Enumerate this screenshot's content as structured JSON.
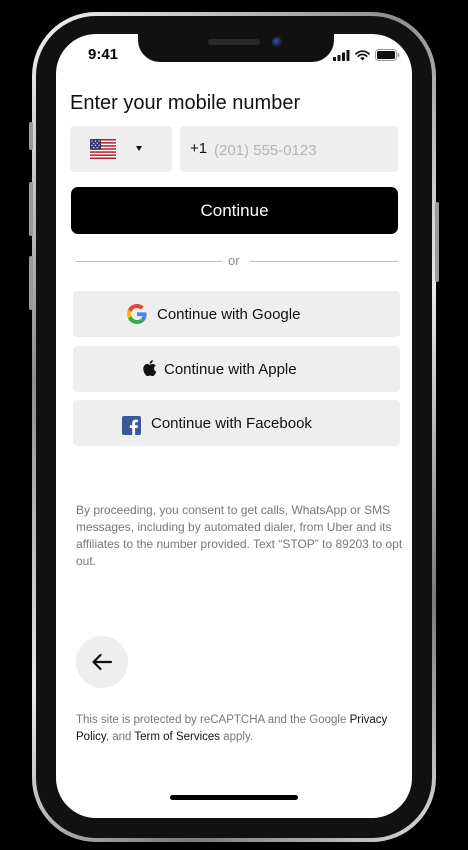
{
  "status_bar": {
    "time": "9:41"
  },
  "screen": {
    "heading": "Enter your mobile number",
    "country_code": "+1",
    "phone_placeholder": "(201) 555-0123",
    "continue_label": "Continue",
    "divider_text": "or",
    "social": [
      {
        "label": "Continue with Google",
        "icon": "google-icon"
      },
      {
        "label": "Continue with Apple",
        "icon": "apple-icon"
      },
      {
        "label": "Continue with Facebook",
        "icon": "facebook-icon"
      }
    ],
    "consent": "By proceeding, you consent to get calls, WhatsApp or SMS messages, including by automated dialer, from Uber and its affiliates to the number provided. Text “STOP” to 89203 to opt out.",
    "recaptcha": {
      "prefix": "This site is protected by reCAPTCHA and the Google ",
      "privacy": "Privacy Policy",
      "middle": ", and ",
      "terms": "Term of Services",
      "suffix": " apply."
    }
  },
  "colors": {
    "button_dark": "#000000",
    "field_bg": "#eeeeee",
    "google_blue": "#4285F4",
    "google_red": "#EA4335",
    "google_yellow": "#FBBC05",
    "google_green": "#34A853",
    "facebook_blue": "#3B5998"
  }
}
